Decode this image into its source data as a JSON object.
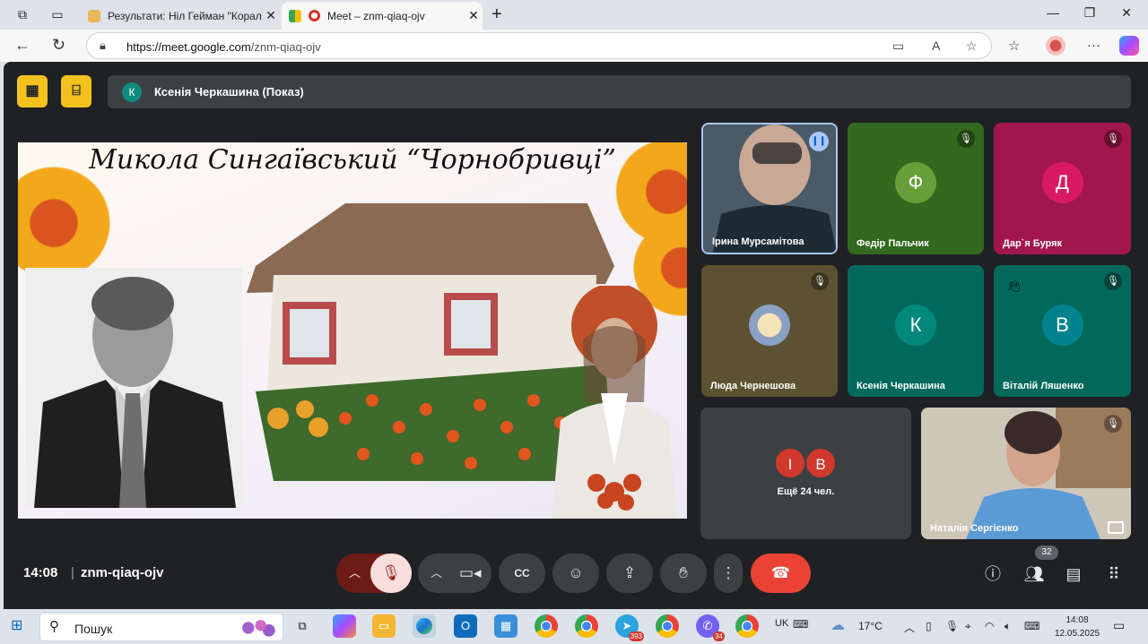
{
  "browser": {
    "tabs": [
      {
        "title": "Результати: Ніл Гейман \"Кораліна\"",
        "active": false
      },
      {
        "title": "Meet – znm-qiaq-ojv",
        "active": true
      }
    ],
    "url_host": "https://meet.google.com",
    "url_path": "/znm-qiaq-ojv"
  },
  "meet": {
    "presenter_initial": "К",
    "presenter_label": "Ксенія Черкашина (Показ)",
    "slide_title": "Микола Сингаївський “Чорнобривці”",
    "participants": [
      {
        "name": "Ірина Мурсамітова",
        "initial": ""
      },
      {
        "name": "Федір Пальчик",
        "initial": "Ф"
      },
      {
        "name": "Дар`я Буряк",
        "initial": "Д"
      },
      {
        "name": "Люда Чернешова",
        "initial": ""
      },
      {
        "name": "Ксенія Черкашина",
        "initial": "К"
      },
      {
        "name": "Віталій Ляшенко",
        "initial": "В"
      },
      {
        "name": "Наталія Сергієнко",
        "initial": ""
      }
    ],
    "more_initials": [
      "І",
      "В"
    ],
    "more_label": "Ещё 24 чел.",
    "time": "14:08",
    "meeting_code": "znm-qiaq-ojv",
    "participant_count": "32"
  },
  "taskbar": {
    "search_placeholder": "Пошук",
    "badges": {
      "telegram": "393",
      "viber": "34"
    },
    "language": "UK",
    "temperature": "17°C",
    "time": "14:08",
    "date": "12.05.2025"
  },
  "colors": {
    "meet_bg": "#202124",
    "control_bg": "#3c4043",
    "hangup_red": "#ea4335",
    "accent_yellow": "#f4c21e"
  }
}
